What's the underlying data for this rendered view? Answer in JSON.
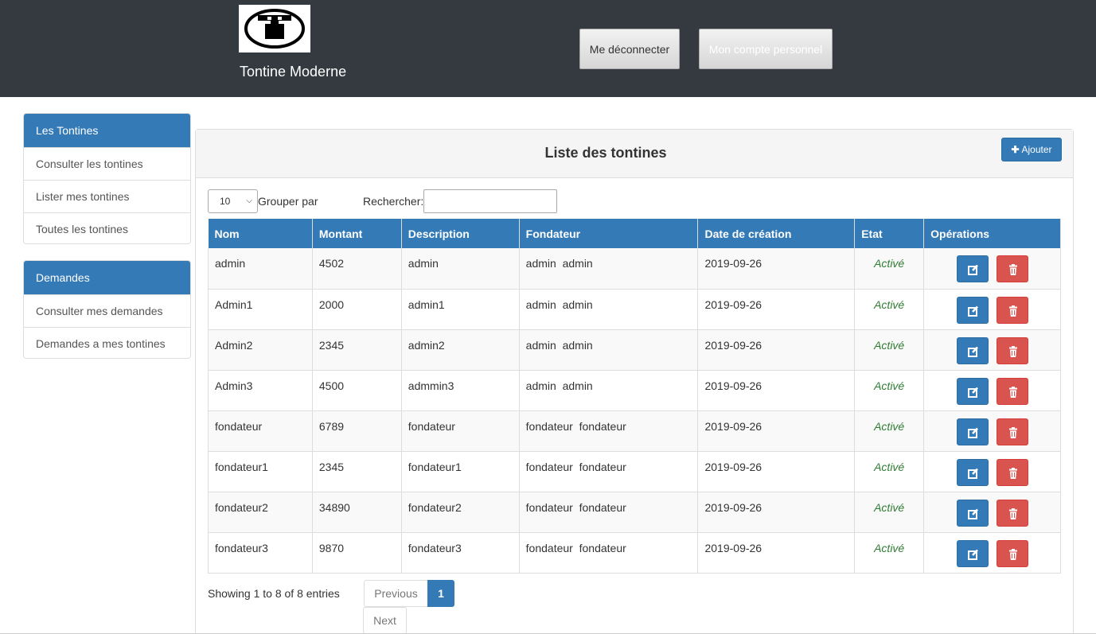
{
  "header": {
    "brand": "Tontine Moderne",
    "logout_label": "Me déconnecter",
    "account_label": "Mon compte personnel"
  },
  "sidebar": {
    "tontines": {
      "title": "Les Tontines",
      "items": [
        "Consulter les tontines",
        "Lister mes tontines",
        "Toutes les tontines"
      ]
    },
    "demandes": {
      "title": "Demandes",
      "items": [
        "Consulter mes demandes",
        "Demandes a mes tontines"
      ]
    }
  },
  "main": {
    "title": "Liste des tontines",
    "add_label": "Ajouter",
    "page_size": "10",
    "group_label": "Grouper par",
    "search_label": "Rechercher:",
    "search_value": "",
    "columns": [
      "Nom",
      "Montant",
      "Description",
      "Fondateur",
      "Date de création",
      "Etat",
      "Opérations"
    ],
    "rows": [
      [
        "admin",
        "4502",
        "admin",
        "admin  admin",
        "2019-09-26",
        "Activé"
      ],
      [
        "Admin1",
        "2000",
        "admin1",
        "admin  admin",
        "2019-09-26",
        "Activé"
      ],
      [
        "Admin2",
        "2345",
        "admin2",
        "admin  admin",
        "2019-09-26",
        "Activé"
      ],
      [
        "Admin3",
        "4500",
        "admmin3",
        "admin  admin",
        "2019-09-26",
        "Activé"
      ],
      [
        "fondateur",
        "6789",
        "fondateur",
        "fondateur  fondateur",
        "2019-09-26",
        "Activé"
      ],
      [
        "fondateur1",
        "2345",
        "fondateur1",
        "fondateur  fondateur",
        "2019-09-26",
        "Activé"
      ],
      [
        "fondateur2",
        "34890",
        "fondateur2",
        "fondateur  fondateur",
        "2019-09-26",
        "Activé"
      ],
      [
        "fondateur3",
        "9870",
        "fondateur3",
        "fondateur  fondateur",
        "2019-09-26",
        "Activé"
      ]
    ],
    "showing": "Showing 1 to 8 of 8 entries",
    "pagination": {
      "previous": "Previous",
      "current": "1",
      "next": "Next"
    }
  },
  "colors": {
    "header_bg": "#343a40",
    "primary": "#337ab7",
    "danger": "#d9534f",
    "active_status": "#2e7d32"
  },
  "icons": [
    "logo-icon",
    "plus-icon",
    "edit-icon",
    "trash-icon",
    "chevron-down-icon"
  ]
}
